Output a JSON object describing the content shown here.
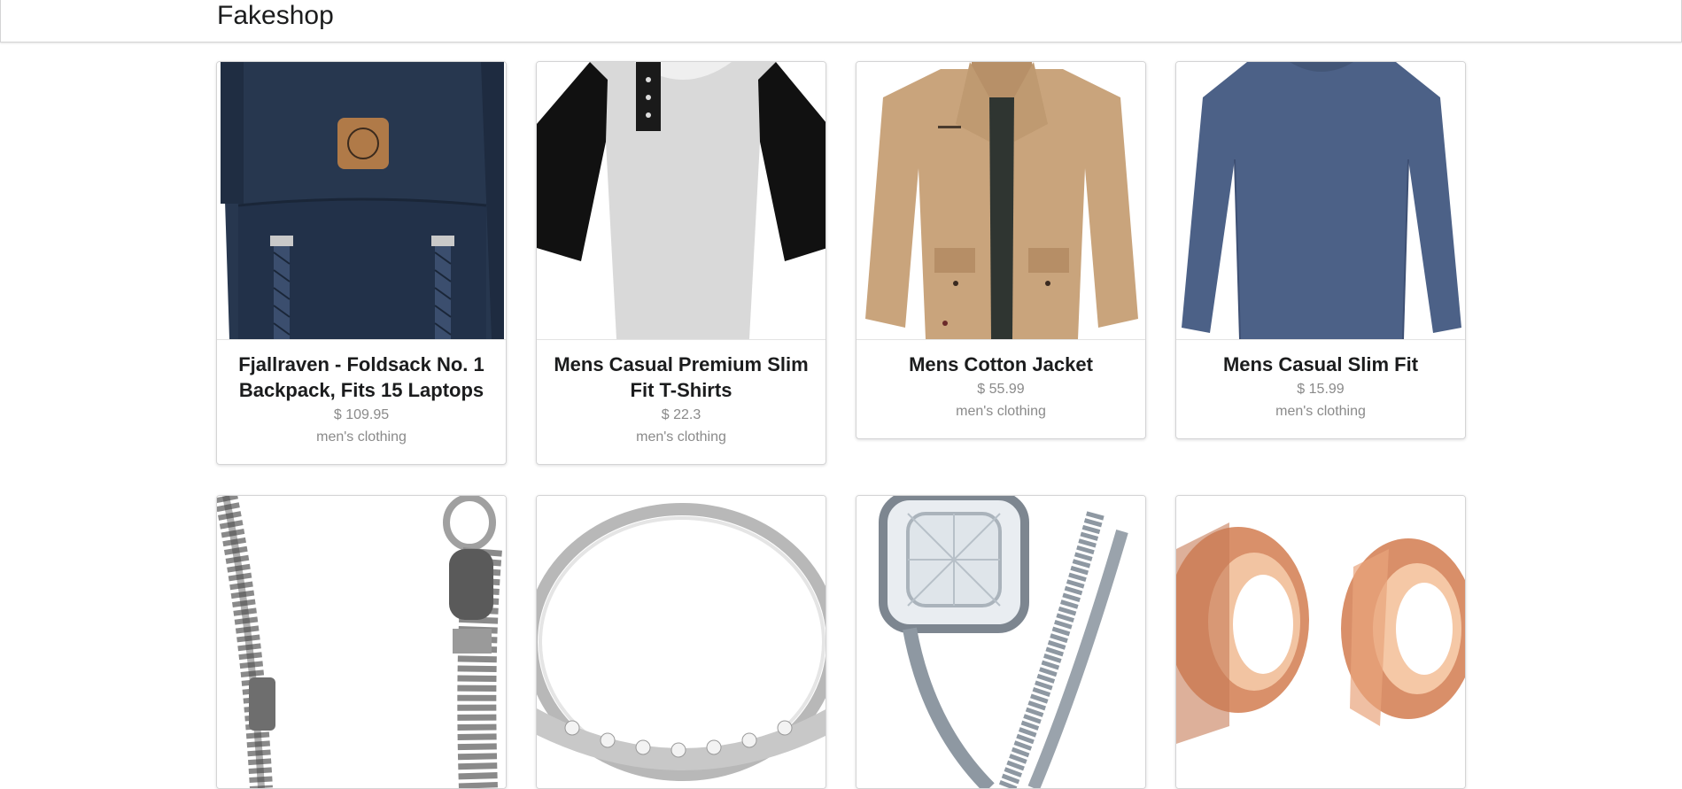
{
  "app": {
    "brand": "Fakeshop"
  },
  "products": [
    {
      "title": "Fjallraven - Foldsack No. 1 Backpack, Fits 15 Laptops",
      "price": "$ 109.95",
      "category": "men's clothing",
      "image": "backpack-image"
    },
    {
      "title": "Mens Casual Premium Slim Fit T-Shirts",
      "price": "$ 22.3",
      "category": "men's clothing",
      "image": "raglan-tshirt-image"
    },
    {
      "title": "Mens Cotton Jacket",
      "price": "$ 55.99",
      "category": "men's clothing",
      "image": "cotton-jacket-image"
    },
    {
      "title": "Mens Casual Slim Fit",
      "price": "$ 15.99",
      "category": "men's clothing",
      "image": "slim-fit-shirt-image"
    },
    {
      "image": "chain-bracelet-image"
    },
    {
      "image": "silver-ring-image"
    },
    {
      "image": "diamond-ring-set-image"
    },
    {
      "image": "rose-gold-plugs-image"
    }
  ],
  "colors": {
    "border": "#d4d4d5",
    "text": "#1b1c1d",
    "muted": "#8a8a8a",
    "backpack": "#27374f",
    "shirt_blue": "#4c6187",
    "jacket": "#c9a47c",
    "rose_gold": "#d9906a"
  }
}
